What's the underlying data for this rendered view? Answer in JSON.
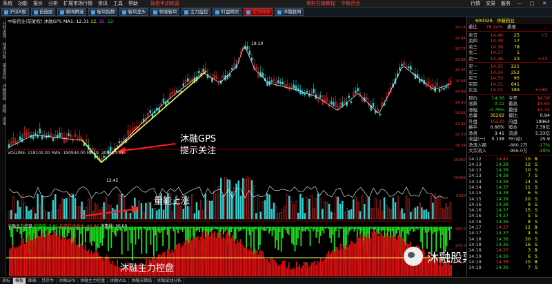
{
  "menu": {
    "items": [
      "系统",
      "功能",
      "报价",
      "分析",
      "扩展市场行情",
      "资讯",
      "工具",
      "帮助"
    ],
    "hot": [
      "操盘手训练营",
      "資料在線教程",
      "中新药业"
    ],
    "right": [
      "行情",
      "交易",
      "服务"
    ]
  },
  "toolbar": {
    "buttons": [
      {
        "label": "沪深A股",
        "red": false
      },
      {
        "label": "自选股",
        "red": false
      },
      {
        "label": "新闻精选",
        "red": false
      },
      {
        "label": "板块指数",
        "red": false
      },
      {
        "label": "板块龙头",
        "red": false
      },
      {
        "label": "领涨板块",
        "red": false
      },
      {
        "label": "主力监控",
        "red": false
      },
      {
        "label": "盯盘精灵",
        "red": false
      },
      {
        "label": "主力持仓",
        "red": true
      },
      {
        "label": "沐融股网",
        "red": false
      }
    ]
  },
  "leftbar": {
    "tabs": [
      "分时走势",
      "技术分析",
      "基本资料",
      "沐融数据",
      "周期",
      "资金"
    ]
  },
  "chart": {
    "header": {
      "name": "中新药业(前复权)",
      "indicator": "沐融GPS",
      "ma1": "MA1: 12.31",
      "m2": "12.",
      "m3": "12.",
      "m4": "12"
    },
    "low_label": "12.45",
    "high_label": "19.10",
    "vol_header": "VOLUME: 218102.00  MA5: 190944.00  MA10: 209614.41",
    "ind_header": {
      "name": "沐融主力控盘",
      "g": "控盘度: 5.81",
      "r": "招商打击准头: 62.94",
      "w": "决策线: 30.00"
    }
  },
  "annotations": {
    "gps_line1": "沐融GPS",
    "gps_line2": "提示关注",
    "volume": "量能上涨",
    "control": "沐融主力控盘"
  },
  "watermark": {
    "text": "沐融股票内参"
  },
  "axis": {
    "price": [
      "19.14",
      "18.44",
      "17.75",
      "17.06",
      "16.37",
      "15.68",
      "14.99",
      "14.30",
      "13.61",
      "12.92",
      "12.23",
      "11.54"
    ],
    "volume": [
      "15000",
      "10000",
      "5000"
    ],
    "indicator": [
      "150.0",
      "100.0",
      "50.0"
    ]
  },
  "quote": {
    "code": "600329",
    "name": "中新药业",
    "weibi_label": "委比",
    "weibi": "76.74%",
    "weicha_label": "委差",
    "weicha": "-",
    "sells": [
      {
        "label": "卖五",
        "price": "14.40",
        "vol": "25",
        "chg": "+3"
      },
      {
        "label": "卖四",
        "price": "14.39",
        "vol": "17",
        "chg": ""
      },
      {
        "label": "卖三",
        "price": "14.38",
        "vol": "78",
        "chg": ""
      },
      {
        "label": "卖二",
        "price": "14.37",
        "vol": "1",
        "chg": ""
      },
      {
        "label": "卖一",
        "price": "14.36",
        "vol": "23",
        "chg": "+23"
      }
    ],
    "buys": [
      {
        "label": "买一",
        "price": "14.35",
        "vol": "221",
        "chg": ""
      },
      {
        "label": "买二",
        "price": "14.34",
        "vol": "252",
        "chg": ""
      },
      {
        "label": "买三",
        "price": "14.33",
        "vol": "95",
        "chg": ""
      },
      {
        "label": "买四",
        "price": "14.31",
        "vol": "641",
        "chg": ""
      },
      {
        "label": "买五",
        "price": "14.31",
        "vol": "189",
        "chg": "+189"
      }
    ],
    "stats": [
      {
        "l1": "现价",
        "v1": "14.36",
        "l2": "今开",
        "v2": "14.50"
      },
      {
        "l1": "涨跌",
        "v1": "-0.11",
        "l2": "最高",
        "v2": "14.65"
      },
      {
        "l1": "涨幅",
        "v1": "-0.76%",
        "l2": "最低",
        "v2": "14.31"
      },
      {
        "l1": "总量",
        "v1": "35202",
        "l2": "量比",
        "v2": "0.94"
      },
      {
        "l1": "外盘",
        "v1": "15230",
        "l2": "内盘",
        "v2": "19964"
      },
      {
        "l1": "换手",
        "v1": "0.66%",
        "l2": "股本",
        "v2": "7.39亿"
      },
      {
        "l1": "净资",
        "v1": "3.41",
        "l2": "流通",
        "v2": "5.33亿"
      },
      {
        "l1": "收益(一)",
        "v1": "0.138",
        "l2": "PE(动)",
        "v2": "25.9"
      },
      {
        "l1": "净流入额",
        "v1": "",
        "l2": "-880.2万",
        "v2": "-17%"
      },
      {
        "l1": "大宗流入",
        "v1": "",
        "l2": "-966.0万",
        "v2": "-19%"
      }
    ],
    "ticks": [
      {
        "t": "14:12",
        "p": "14.42",
        "v": "10",
        "s": "B"
      },
      {
        "t": "14:13",
        "p": "14.38",
        "v": "12",
        "s": "S"
      },
      {
        "t": "14:13",
        "p": "14.38",
        "v": "10",
        "s": "S"
      },
      {
        "t": "14:13",
        "p": "14.38",
        "v": "7",
        "s": "S"
      },
      {
        "t": "14:14",
        "p": "14.38",
        "v": "14",
        "s": "S"
      },
      {
        "t": "14:14",
        "p": "14.37",
        "v": "11",
        "s": "S"
      },
      {
        "t": "14:15",
        "p": "14.38",
        "v": "6",
        "s": "S"
      },
      {
        "t": "14:15",
        "p": "14.38",
        "v": "20",
        "s": "S"
      },
      {
        "t": "14:16",
        "p": "14.38",
        "v": "9",
        "s": "S"
      },
      {
        "t": "14:16",
        "p": "14.37",
        "v": "15",
        "s": "S"
      },
      {
        "t": "14:16",
        "p": "14.37",
        "v": "5",
        "s": "S"
      },
      {
        "t": "14:16",
        "p": "14.36",
        "v": "8",
        "s": "S"
      },
      {
        "t": "14:17",
        "p": "14.37",
        "v": "12",
        "s": "B"
      },
      {
        "t": "14:17",
        "p": "14.37",
        "v": "4",
        "s": "S"
      },
      {
        "t": "14:18",
        "p": "14.36",
        "v": "30",
        "s": "S"
      },
      {
        "t": "14:18",
        "p": "14.36",
        "v": "16",
        "s": "S"
      },
      {
        "t": "14:18",
        "p": "14.37",
        "v": "3",
        "s": "B"
      },
      {
        "t": "14:19",
        "p": "14.36",
        "v": "6",
        "s": "S"
      },
      {
        "t": "14:19",
        "p": "14.38",
        "v": "10",
        "s": "B"
      },
      {
        "t": "14:19",
        "p": "14.36",
        "v": "7",
        "s": "S"
      }
    ]
  },
  "bottom_tabs": [
    {
      "label": "指标",
      "active": false
    },
    {
      "label": "模板",
      "active": true
    },
    {
      "label": "图表",
      "active": false
    },
    {
      "label": "另存为",
      "active": false
    },
    {
      "label": "沐融GPS",
      "active": false
    },
    {
      "label": "沐融主力控盘",
      "active": false
    },
    {
      "label": "沐融VOL",
      "active": false
    },
    {
      "label": "沐融决策线",
      "active": false
    },
    {
      "label": "沐融波动分析",
      "active": false
    }
  ]
}
